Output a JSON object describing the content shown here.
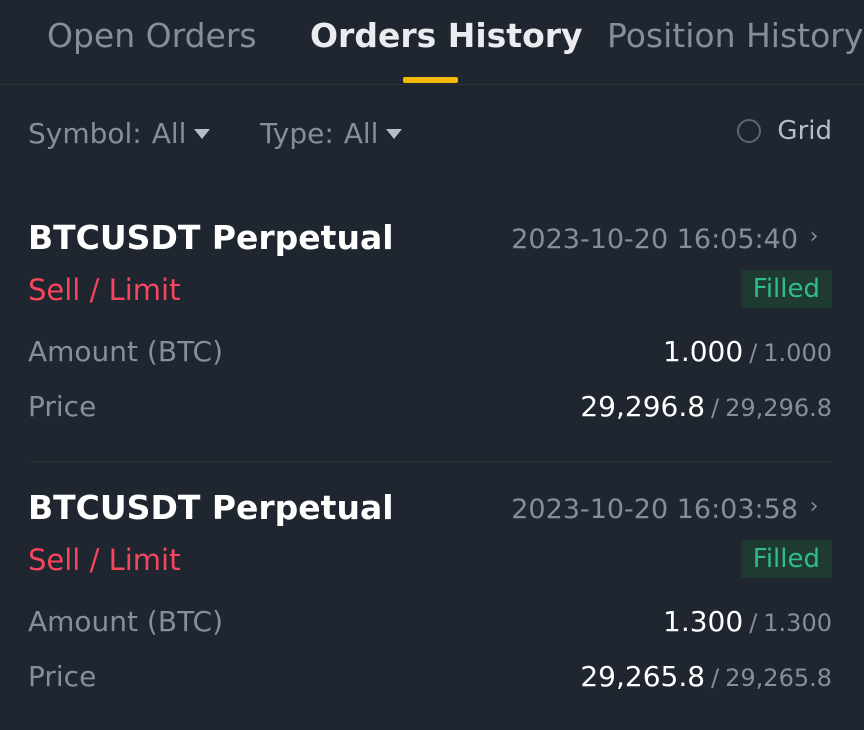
{
  "tabs": [
    {
      "label": "Open Orders",
      "active": false
    },
    {
      "label": "Orders History",
      "active": true
    },
    {
      "label": "Position History",
      "active": false
    }
  ],
  "filters": {
    "symbol_label": "Symbol:",
    "symbol_value": "All",
    "type_label": "Type:",
    "type_value": "All",
    "grid_label": "Grid"
  },
  "orders": [
    {
      "symbol": "BTCUSDT Perpetual",
      "time": "2023-10-20 16:05:40",
      "side": "Sell / Limit",
      "status": "Filled",
      "amount_label": "Amount (BTC)",
      "amount_filled": "1.000",
      "amount_total": "1.000",
      "price_label": "Price",
      "price_avg": "29,296.8",
      "price_order": "29,296.8"
    },
    {
      "symbol": "BTCUSDT Perpetual",
      "time": "2023-10-20 16:03:58",
      "side": "Sell / Limit",
      "status": "Filled",
      "amount_label": "Amount (BTC)",
      "amount_filled": "1.300",
      "amount_total": "1.300",
      "price_label": "Price",
      "price_avg": "29,265.8",
      "price_order": "29,265.8"
    }
  ],
  "separator": "/",
  "colors": {
    "background": "#1f2630",
    "accent": "#f0b90b",
    "sell": "#f6465d",
    "filled": "#2ebd85"
  }
}
